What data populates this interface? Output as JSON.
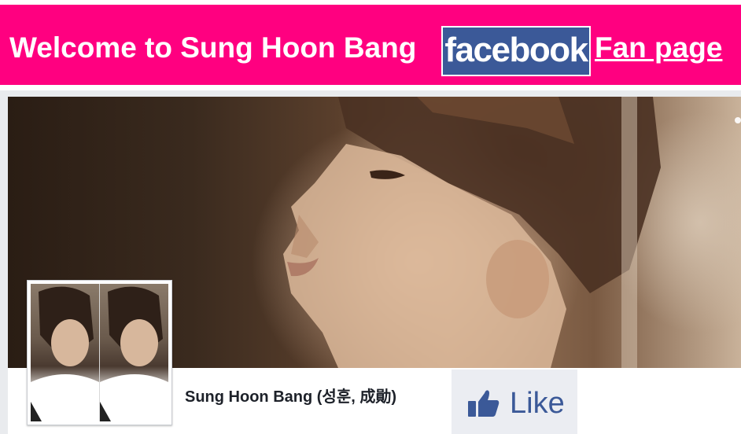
{
  "banner": {
    "welcome_text": "Welcome to Sung Hoon Bang",
    "facebook_logo_text": "facebook",
    "fan_page_link": "Fan page",
    "background_color": "#ff0080"
  },
  "cover": {
    "image": "cover-photo"
  },
  "profile": {
    "image": "profile-photo",
    "page_name": "Sung Hoon Bang (성훈, 成勛)"
  },
  "like_button": {
    "icon": "thumbs-up-icon",
    "label": "Like",
    "color": "#3b5998"
  }
}
